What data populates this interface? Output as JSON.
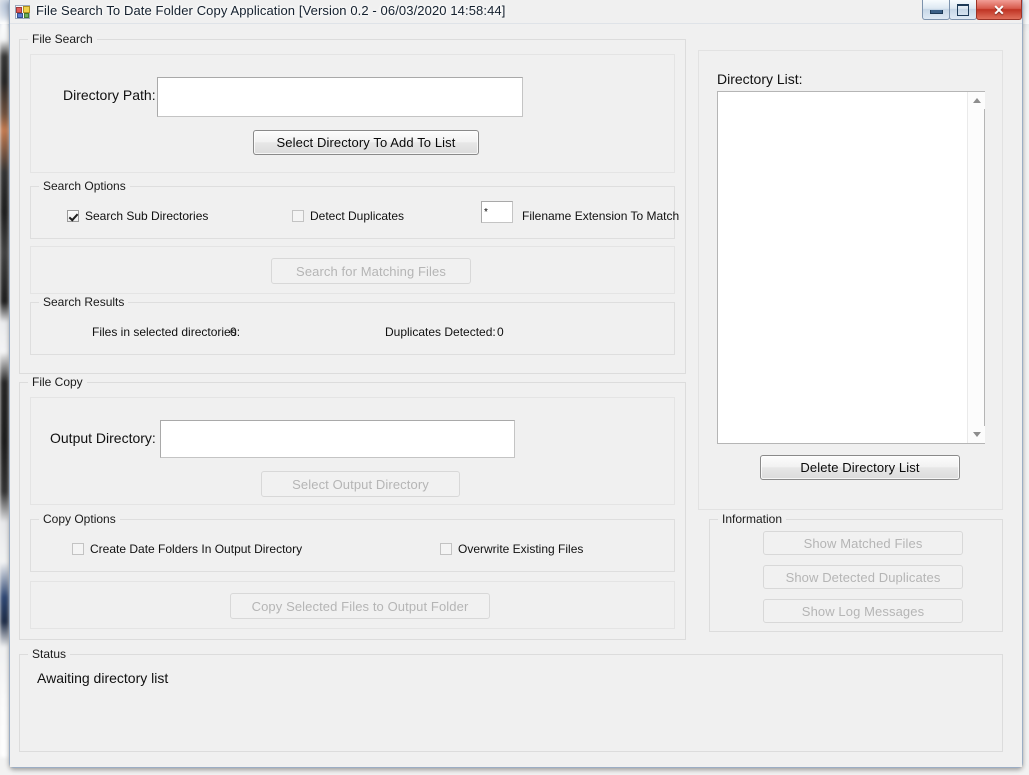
{
  "window": {
    "title": "File Search To Date Folder Copy Application [Version 0.2 - 06/03/2020 14:58:44]",
    "icon": "application-form-icon",
    "controls": {
      "minimize": "minimize-icon",
      "maximize": "maximize-icon",
      "close": "✕"
    }
  },
  "file_search": {
    "group_title": "File Search",
    "directory_path_label": "Directory Path:",
    "directory_path_value": "",
    "select_directory_button": "Select Directory To Add To List",
    "search_options": {
      "group_title": "Search Options",
      "search_sub_directories": {
        "label": "Search Sub Directories",
        "checked": true
      },
      "detect_duplicates": {
        "label": "Detect Duplicates",
        "checked": false
      },
      "extension_value": "*",
      "extension_label": "Filename Extension To Match"
    },
    "search_button": {
      "label": "Search for Matching Files",
      "enabled": false
    },
    "search_results": {
      "group_title": "Search Results",
      "files_label": "Files in selected directories:",
      "files_count": "0",
      "duplicates_label": "Duplicates Detected:",
      "duplicates_count": "0"
    }
  },
  "file_copy": {
    "group_title": "File Copy",
    "output_directory_label": "Output Directory:",
    "output_directory_value": "",
    "select_output_button": {
      "label": "Select Output Directory",
      "enabled": false
    },
    "copy_options": {
      "group_title": "Copy Options",
      "create_date_folders": {
        "label": "Create Date Folders In Output Directory",
        "checked": false
      },
      "overwrite_existing": {
        "label": "Overwrite Existing Files",
        "checked": false
      }
    },
    "copy_button": {
      "label": "Copy Selected Files to Output Folder",
      "enabled": false
    }
  },
  "directory_list": {
    "label": "Directory List:",
    "items": [],
    "delete_button": {
      "label": "Delete Directory List",
      "enabled": true
    }
  },
  "information": {
    "group_title": "Information",
    "buttons": [
      {
        "label": "Show Matched Files",
        "enabled": false
      },
      {
        "label": "Show Detected Duplicates",
        "enabled": false
      },
      {
        "label": "Show Log Messages",
        "enabled": false
      }
    ]
  },
  "status": {
    "group_title": "Status",
    "message": "Awaiting directory list"
  }
}
